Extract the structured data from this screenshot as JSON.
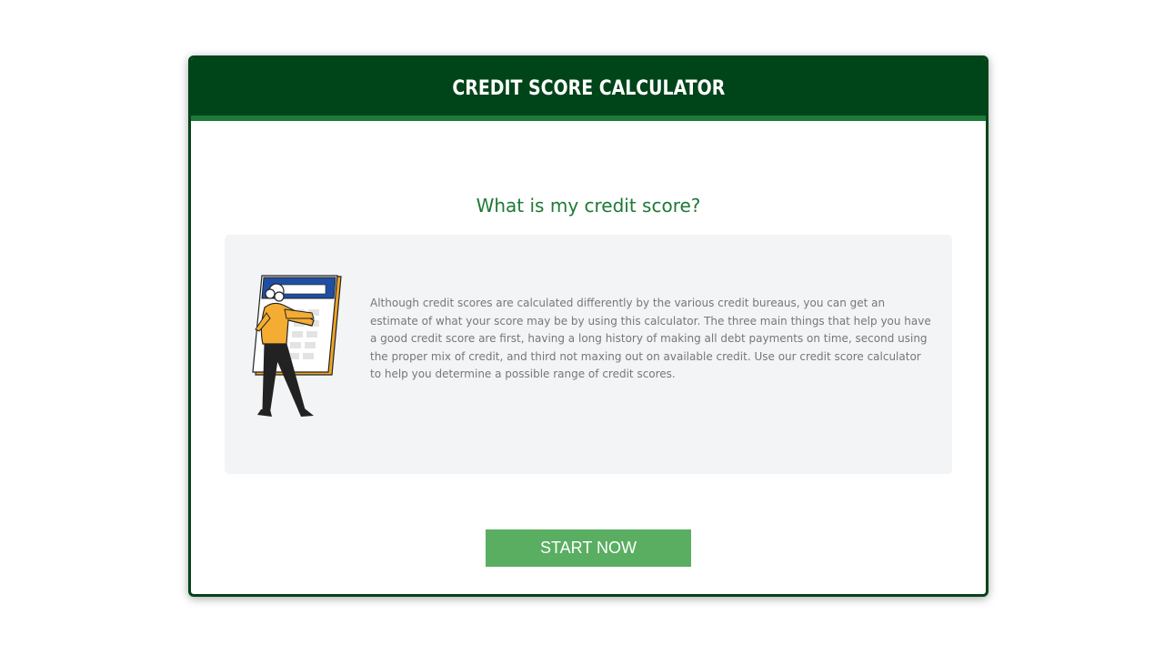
{
  "header": {
    "title": "CREDIT SCORE CALCULATOR"
  },
  "main": {
    "question": "What is my credit score?",
    "description": "Although credit scores are calculated differently by the various credit bureaus, you can get an estimate of what your score may be by using this calculator. The three main things that help you have a good credit score are first, having a long history of making all debt payments on time, second using the proper mix of credit, and third not maxing out on available credit. Use our credit score calculator to help you determine a possible range of credit scores.",
    "illustration": "person-with-calculator-illustration",
    "start_button_label": "START NOW"
  },
  "colors": {
    "header_bg": "#004419",
    "header_stripe": "#1c7a3a",
    "question_text": "#1d7a35",
    "panel_bg": "#f3f4f5",
    "button_bg": "#5aae62"
  }
}
